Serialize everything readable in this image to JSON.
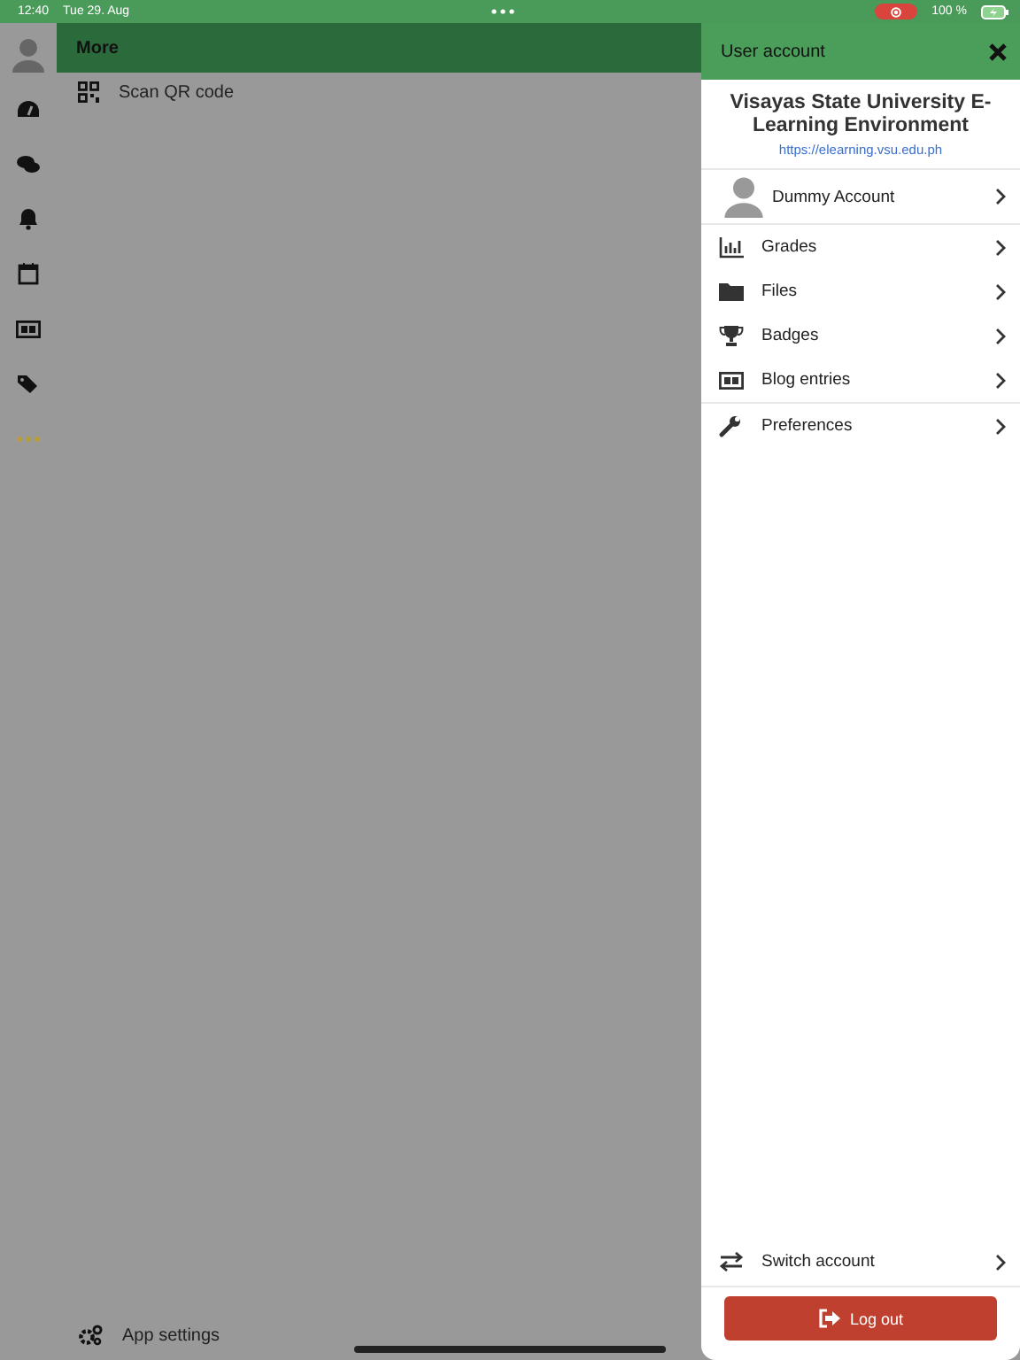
{
  "status_bar": {
    "time": "12:40",
    "date": "Tue 29. Aug",
    "battery": "100 %"
  },
  "sidebar": {
    "items": [
      {
        "selected": false
      },
      {
        "selected": false
      },
      {
        "selected": false
      },
      {
        "selected": false
      },
      {
        "selected": false
      },
      {
        "selected": false
      },
      {
        "selected": true
      }
    ]
  },
  "main": {
    "title": "More",
    "items": [
      {
        "label": "Scan QR code"
      }
    ],
    "footer_item": {
      "label": "App settings"
    }
  },
  "panel": {
    "title": "User account",
    "site_name": "Visayas State University E-Learning Environment",
    "site_url": "https://elearning.vsu.edu.ph",
    "account": {
      "label": "Dummy Account"
    },
    "items": [
      {
        "label": "Grades"
      },
      {
        "label": "Files"
      },
      {
        "label": "Badges"
      },
      {
        "label": "Blog entries"
      },
      {
        "label": "Preferences"
      }
    ],
    "switch_account": {
      "label": "Switch account"
    },
    "logout": {
      "label": "Log out"
    }
  }
}
